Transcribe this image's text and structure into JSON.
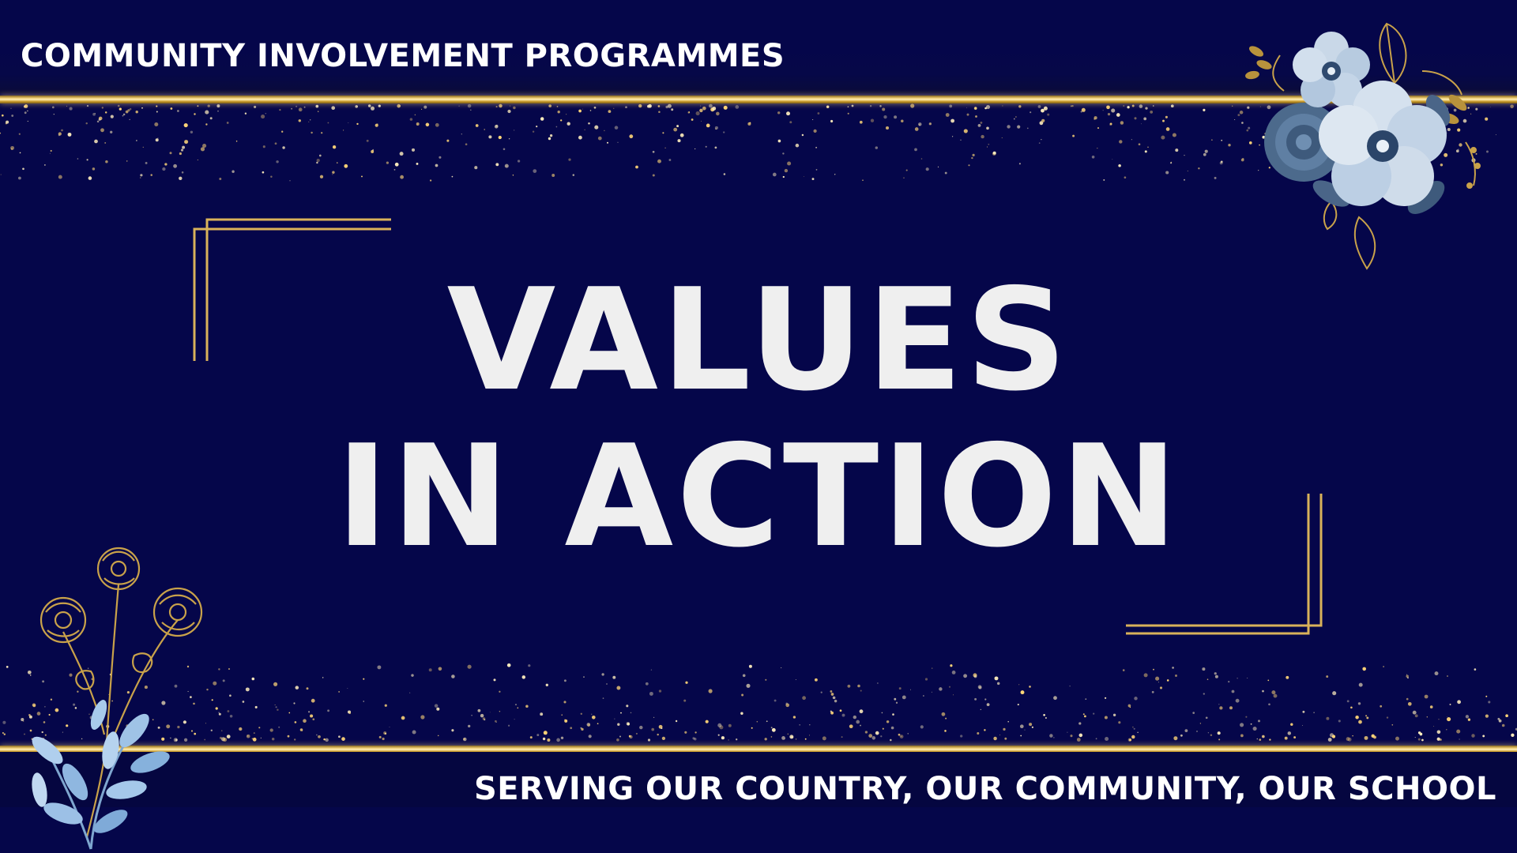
{
  "header": {
    "label": "COMMUNITY INVOLVEMENT PROGRAMMES"
  },
  "title": {
    "line1": "VALUES",
    "line2": "IN ACTION"
  },
  "footer": {
    "tagline": "SERVING OUR COUNTRY, OUR COMMUNITY, OUR SCHOOL"
  },
  "colors": {
    "background": "#05064a",
    "gold": "#e6c068",
    "title_text": "#efefef",
    "label_text": "#ffffff",
    "flower_blue": "#a9c2dc"
  },
  "decorations": [
    "gold-sparkle-band-top",
    "gold-sparkle-band-bottom",
    "blue-flower-bouquet-icon",
    "gold-line-flower-icon",
    "corner-frame-top-left",
    "corner-frame-bottom-right"
  ]
}
